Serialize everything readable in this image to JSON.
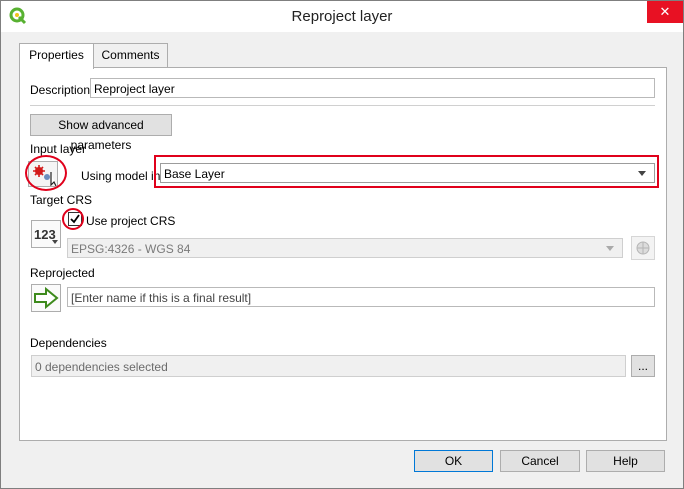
{
  "window": {
    "title": "Reproject layer",
    "close_glyph": "✕"
  },
  "tabs": [
    {
      "label": "Properties"
    },
    {
      "label": "Comments"
    }
  ],
  "description": {
    "label": "Description",
    "value": "Reproject layer"
  },
  "advanced_button": "Show advanced parameters",
  "input_layer": {
    "label": "Input layer",
    "mode_label": "Using model input",
    "value": "Base Layer",
    "icon": "model-input-icon"
  },
  "target_crs": {
    "label": "Target CRS",
    "checkbox_label": "Use project CRS",
    "checked": true,
    "value": "EPSG:4326 - WGS 84",
    "icon_text": "123"
  },
  "reprojected": {
    "label": "Reprojected",
    "placeholder": "[Enter name if this is a final result]",
    "icon": "output-arrow-icon"
  },
  "dependencies": {
    "label": "Dependencies",
    "value": "0 dependencies selected",
    "browse": "..."
  },
  "buttons": {
    "ok": "OK",
    "cancel": "Cancel",
    "help": "Help"
  },
  "colors": {
    "highlight": "#e0001b",
    "default_button_border": "#0078d7",
    "close_button": "#e81123"
  }
}
